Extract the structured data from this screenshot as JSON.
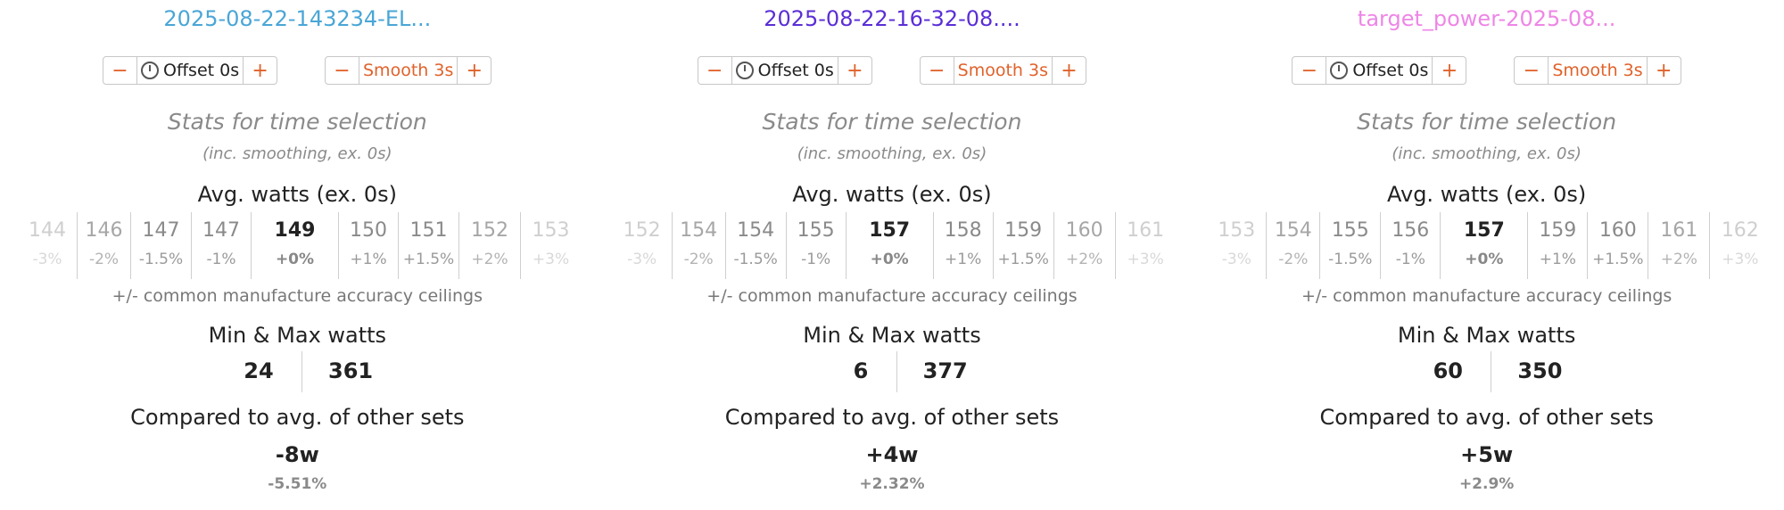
{
  "colors": {
    "accent": "#e0622b",
    "title_blue": "#4aa6d6",
    "title_purple": "#5a2ed6",
    "title_pink": "#ee86e6"
  },
  "panels": [
    {
      "title": "2025-08-22-143234-EL...",
      "title_color": "#4aa6d6",
      "offset": {
        "minus": "−",
        "label": "Offset 0s",
        "plus": "+",
        "icon": "clock-icon"
      },
      "smooth": {
        "minus": "−",
        "label": "Smooth 3s",
        "plus": "+"
      },
      "stats_title": "Stats for time selection",
      "stats_sub": "(inc. smoothing, ex. 0s)",
      "avg_heading": "Avg. watts (ex. 0s)",
      "cells": [
        {
          "value": "144",
          "pct": "-3%"
        },
        {
          "value": "146",
          "pct": "-2%"
        },
        {
          "value": "147",
          "pct": "-1.5%"
        },
        {
          "value": "147",
          "pct": "-1%"
        },
        {
          "value": "149",
          "pct": "+0%"
        },
        {
          "value": "150",
          "pct": "+1%"
        },
        {
          "value": "151",
          "pct": "+1.5%"
        },
        {
          "value": "152",
          "pct": "+2%"
        },
        {
          "value": "153",
          "pct": "+3%"
        }
      ],
      "accuracy_note": "+/- common manufacture accuracy ceilings",
      "minmax_heading": "Min & Max watts",
      "min": "24",
      "max": "361",
      "compare_heading": "Compared to avg. of other sets",
      "compare_watts": "-8w",
      "compare_pct": "-5.51%"
    },
    {
      "title": "2025-08-22-16-32-08....",
      "title_color": "#5a2ed6",
      "offset": {
        "minus": "−",
        "label": "Offset 0s",
        "plus": "+",
        "icon": "clock-icon"
      },
      "smooth": {
        "minus": "−",
        "label": "Smooth 3s",
        "plus": "+"
      },
      "stats_title": "Stats for time selection",
      "stats_sub": "(inc. smoothing, ex. 0s)",
      "avg_heading": "Avg. watts (ex. 0s)",
      "cells": [
        {
          "value": "152",
          "pct": "-3%"
        },
        {
          "value": "154",
          "pct": "-2%"
        },
        {
          "value": "154",
          "pct": "-1.5%"
        },
        {
          "value": "155",
          "pct": "-1%"
        },
        {
          "value": "157",
          "pct": "+0%"
        },
        {
          "value": "158",
          "pct": "+1%"
        },
        {
          "value": "159",
          "pct": "+1.5%"
        },
        {
          "value": "160",
          "pct": "+2%"
        },
        {
          "value": "161",
          "pct": "+3%"
        }
      ],
      "accuracy_note": "+/- common manufacture accuracy ceilings",
      "minmax_heading": "Min & Max watts",
      "min": "6",
      "max": "377",
      "compare_heading": "Compared to avg. of other sets",
      "compare_watts": "+4w",
      "compare_pct": "+2.32%"
    },
    {
      "title": "target_power-2025-08...",
      "title_color": "#ee86e6",
      "offset": {
        "minus": "−",
        "label": "Offset 0s",
        "plus": "+",
        "icon": "clock-icon"
      },
      "smooth": {
        "minus": "−",
        "label": "Smooth 3s",
        "plus": "+"
      },
      "stats_title": "Stats for time selection",
      "stats_sub": "(inc. smoothing, ex. 0s)",
      "avg_heading": "Avg. watts (ex. 0s)",
      "cells": [
        {
          "value": "153",
          "pct": "-3%"
        },
        {
          "value": "154",
          "pct": "-2%"
        },
        {
          "value": "155",
          "pct": "-1.5%"
        },
        {
          "value": "156",
          "pct": "-1%"
        },
        {
          "value": "157",
          "pct": "+0%"
        },
        {
          "value": "159",
          "pct": "+1%"
        },
        {
          "value": "160",
          "pct": "+1.5%"
        },
        {
          "value": "161",
          "pct": "+2%"
        },
        {
          "value": "162",
          "pct": "+3%"
        }
      ],
      "accuracy_note": "+/- common manufacture accuracy ceilings",
      "minmax_heading": "Min & Max watts",
      "min": "60",
      "max": "350",
      "compare_heading": "Compared to avg. of other sets",
      "compare_watts": "+5w",
      "compare_pct": "+2.9%"
    }
  ]
}
